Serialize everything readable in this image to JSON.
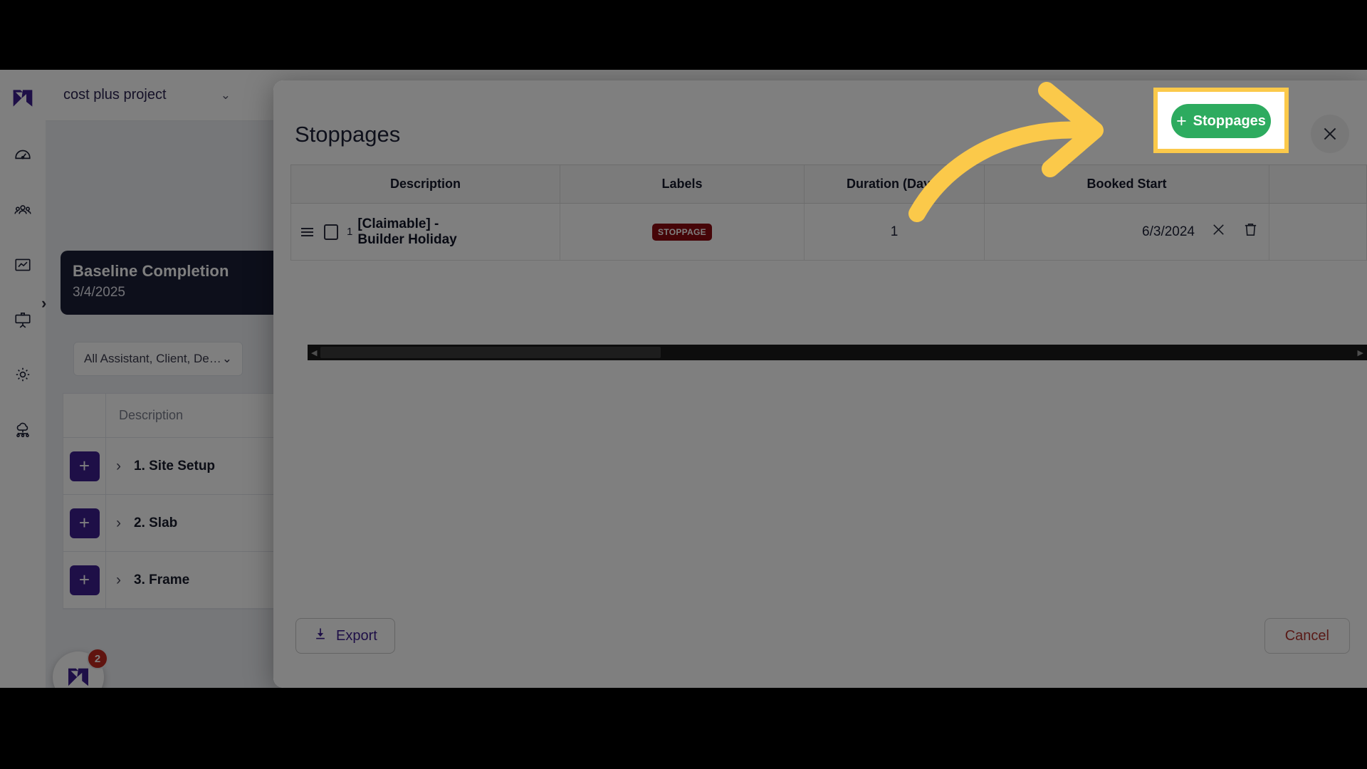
{
  "app": {
    "sidebar": {
      "logo_icon": "buildxact-m-logo-icon",
      "items": [
        {
          "icon": "speedometer-icon",
          "name": "dashboard"
        },
        {
          "icon": "people-icon",
          "name": "contacts"
        },
        {
          "icon": "chart-trend-icon",
          "name": "reports"
        },
        {
          "icon": "presentation-board-icon",
          "name": "schedule"
        },
        {
          "icon": "gear-icon",
          "name": "settings"
        },
        {
          "icon": "cloud-network-icon",
          "name": "integrations"
        }
      ]
    },
    "project_selector": {
      "value": "cost plus project",
      "chevron": "chevron-down-icon"
    },
    "baseline_card": {
      "title": "Baseline Completion",
      "date": "3/4/2025"
    },
    "filter": {
      "value": "All Assistant, Client, De…",
      "chevron": "chevron-down-icon"
    },
    "bg_table": {
      "header": {
        "description": "Description"
      },
      "rows": [
        {
          "add": "+",
          "chevron": "chevron-right-icon",
          "label": "1. Site Setup"
        },
        {
          "add": "+",
          "chevron": "chevron-right-icon",
          "label": "2. Slab"
        },
        {
          "add": "+",
          "chevron": "chevron-right-icon",
          "label": "3. Frame"
        }
      ]
    },
    "fab": {
      "icon": "buildxact-m-logo-icon",
      "badge": "2"
    },
    "expand_chevron": "chevron-right-icon"
  },
  "modal": {
    "title": "Stoppages",
    "close_icon": "close-icon",
    "add_button": {
      "label": "Stoppages",
      "plus": "+",
      "color": "#2dab5f"
    },
    "table": {
      "columns": [
        "Description",
        "Labels",
        "Duration (Days)",
        "Booked Start"
      ],
      "rows": [
        {
          "drag_handle": "drag-handle-icon",
          "checkbox": "checkbox-icon",
          "number": "1",
          "description_line1": "[Claimable] -",
          "description_line2": "Builder Holiday",
          "label_chip": "STOPPAGE",
          "label_chip_color": "#8d0b11",
          "duration": "1",
          "booked_start": "6/3/2024",
          "remove_icon": "close-icon",
          "delete_icon": "trash-icon"
        }
      ]
    },
    "scrollbar": {
      "left_arrow": "◀",
      "right_arrow": "▶"
    },
    "footer": {
      "export_label": "Export",
      "export_icon": "download-icon",
      "export_color": "#3d1f8f",
      "cancel_label": "Cancel",
      "cancel_color": "#b3352f"
    }
  },
  "annotation": {
    "highlight_color": "#fbc94a",
    "arrow_icon": "curved-arrow-right-icon"
  }
}
